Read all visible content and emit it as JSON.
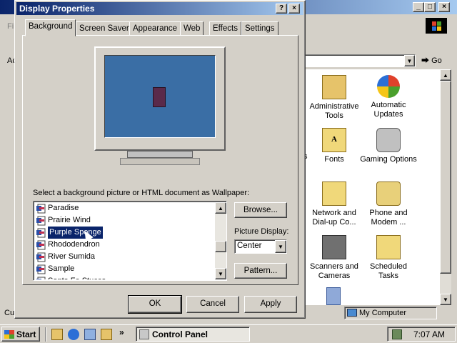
{
  "behind_window": {
    "address_go": "Go",
    "items": [
      {
        "label": "Administrative Tools",
        "icon": "admin-tools-icon"
      },
      {
        "label": "Automatic Updates",
        "icon": "windows-update-icon"
      },
      {
        "label": "Fonts",
        "icon": "fonts-folder-icon"
      },
      {
        "label": "Gaming Options",
        "icon": "joystick-icon"
      },
      {
        "label": "Network and Dial-up Co...",
        "icon": "network-folder-icon"
      },
      {
        "label": "Phone and Modem ...",
        "icon": "phone-icon"
      },
      {
        "label": "Scanners and Cameras",
        "icon": "scanner-icon"
      },
      {
        "label": "Scheduled Tasks",
        "icon": "scheduled-tasks-icon"
      }
    ],
    "status_right": "My Computer",
    "partial_left_letters": [
      "Fi",
      "Ac",
      "Cus"
    ],
    "partial_text_s": "s"
  },
  "dialog": {
    "title": "Display Properties",
    "tabs": [
      "Background",
      "Screen Saver",
      "Appearance",
      "Web",
      "Effects",
      "Settings"
    ],
    "wallpaper_label": "Select a background picture or HTML document as Wallpaper:",
    "list_items": [
      "Paradise",
      "Prairie Wind",
      "Purple Sponge",
      "Rhododendron",
      "River Sumida",
      "Sample",
      "Santa Fe Stucco"
    ],
    "selected_item": "Purple Sponge",
    "browse_label": "Browse...",
    "picture_display_label": "Picture Display:",
    "picture_display_value": "Center",
    "pattern_label": "Pattern...",
    "ok_label": "OK",
    "cancel_label": "Cancel",
    "apply_label": "Apply",
    "preview_desktop_color": "#3a6ea5"
  },
  "taskbar": {
    "start_label": "Start",
    "task_label": "Control Panel",
    "clock": "7:07 AM"
  }
}
